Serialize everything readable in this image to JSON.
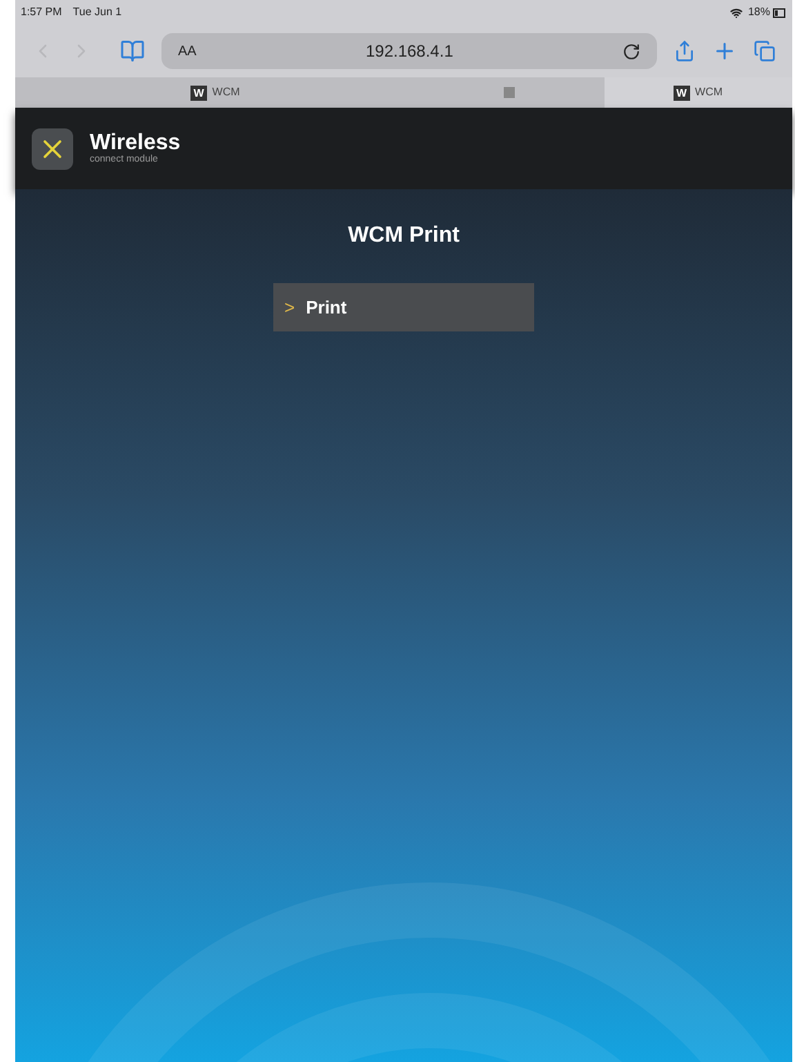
{
  "status_bar": {
    "time": "1:57 PM",
    "date": "Tue Jun 1",
    "battery": "18%"
  },
  "browser": {
    "text_size_button": "AA",
    "url": "192.168.4.1"
  },
  "tabs": [
    {
      "label": "WCM",
      "favicon": "W",
      "selected": false
    },
    {
      "selected": false
    },
    {
      "label": "WCM",
      "favicon": "W",
      "selected": true
    }
  ],
  "header": {
    "logo_title": "Wireless",
    "logo_subtitle": "connect module"
  },
  "page": {
    "title": "WCM Print",
    "menu_items": [
      {
        "label": "Print",
        "chevron": ">"
      }
    ]
  }
}
